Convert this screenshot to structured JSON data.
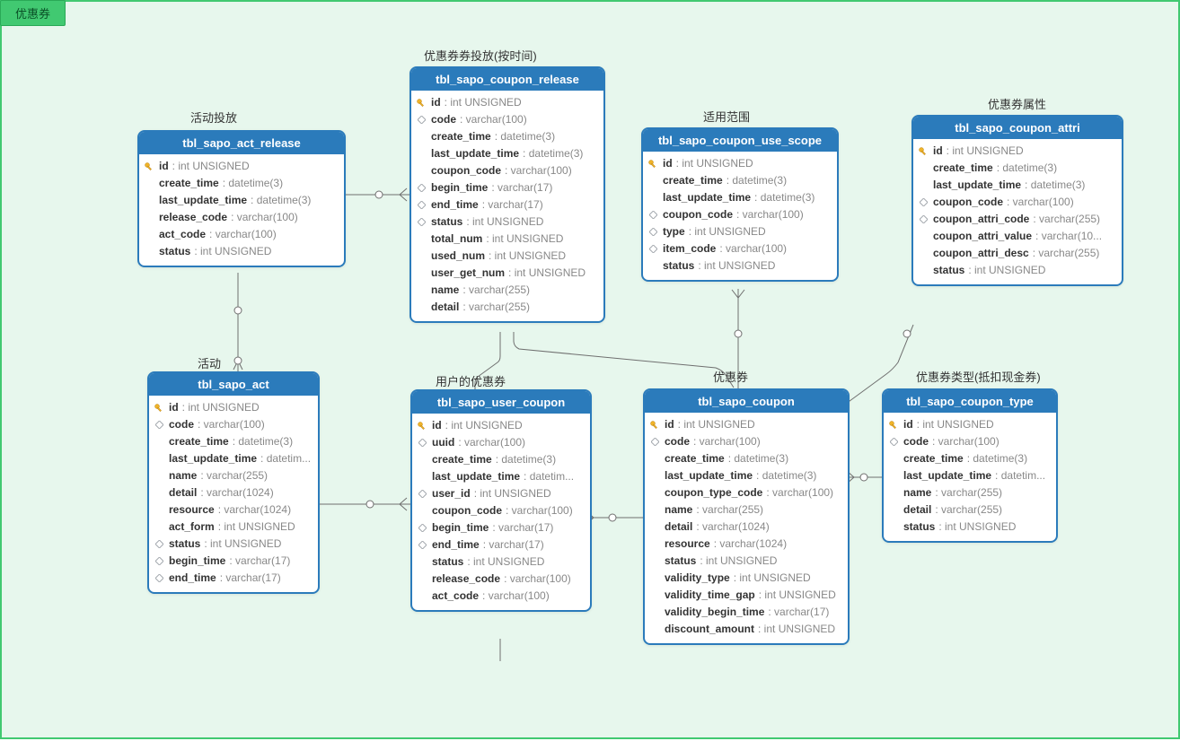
{
  "frame_tag": "优惠券",
  "labels": {
    "act_release": "活动投放",
    "act": "活动",
    "coupon_release": "优惠券券投放(按时间)",
    "user_coupon": "用户的优惠券",
    "coupon": "优惠券",
    "use_scope": "适用范围",
    "attri": "优惠券属性",
    "type": "优惠券类型(抵扣现金券)"
  },
  "entities": {
    "act_release": {
      "name": "tbl_sapo_act_release",
      "cols": [
        {
          "icon": "pk",
          "name": "id",
          "type": "int UNSIGNED"
        },
        {
          "icon": "",
          "name": "create_time",
          "type": "datetime(3)"
        },
        {
          "icon": "",
          "name": "last_update_time",
          "type": "datetime(3)"
        },
        {
          "icon": "",
          "name": "release_code",
          "type": "varchar(100)"
        },
        {
          "icon": "",
          "name": "act_code",
          "type": "varchar(100)"
        },
        {
          "icon": "",
          "name": "status",
          "type": "int UNSIGNED"
        }
      ]
    },
    "act": {
      "name": "tbl_sapo_act",
      "cols": [
        {
          "icon": "pk",
          "name": "id",
          "type": "int UNSIGNED"
        },
        {
          "icon": "idx",
          "name": "code",
          "type": "varchar(100)"
        },
        {
          "icon": "",
          "name": "create_time",
          "type": "datetime(3)"
        },
        {
          "icon": "",
          "name": "last_update_time",
          "type": "datetim..."
        },
        {
          "icon": "",
          "name": "name",
          "type": "varchar(255)"
        },
        {
          "icon": "",
          "name": "detail",
          "type": "varchar(1024)"
        },
        {
          "icon": "",
          "name": "resource",
          "type": "varchar(1024)"
        },
        {
          "icon": "",
          "name": "act_form",
          "type": "int UNSIGNED"
        },
        {
          "icon": "idx",
          "name": "status",
          "type": "int UNSIGNED"
        },
        {
          "icon": "idx",
          "name": "begin_time",
          "type": "varchar(17)"
        },
        {
          "icon": "idx",
          "name": "end_time",
          "type": "varchar(17)"
        }
      ]
    },
    "coupon_release": {
      "name": "tbl_sapo_coupon_release",
      "cols": [
        {
          "icon": "pk",
          "name": "id",
          "type": "int UNSIGNED"
        },
        {
          "icon": "idx",
          "name": "code",
          "type": "varchar(100)"
        },
        {
          "icon": "",
          "name": "create_time",
          "type": "datetime(3)"
        },
        {
          "icon": "",
          "name": "last_update_time",
          "type": "datetime(3)"
        },
        {
          "icon": "",
          "name": "coupon_code",
          "type": "varchar(100)"
        },
        {
          "icon": "idx",
          "name": "begin_time",
          "type": "varchar(17)"
        },
        {
          "icon": "idx",
          "name": "end_time",
          "type": "varchar(17)"
        },
        {
          "icon": "idx",
          "name": "status",
          "type": "int UNSIGNED"
        },
        {
          "icon": "",
          "name": "total_num",
          "type": "int UNSIGNED"
        },
        {
          "icon": "",
          "name": "used_num",
          "type": "int UNSIGNED"
        },
        {
          "icon": "",
          "name": "user_get_num",
          "type": "int UNSIGNED"
        },
        {
          "icon": "",
          "name": "name",
          "type": "varchar(255)"
        },
        {
          "icon": "",
          "name": "detail",
          "type": "varchar(255)"
        }
      ]
    },
    "user_coupon": {
      "name": "tbl_sapo_user_coupon",
      "cols": [
        {
          "icon": "pk",
          "name": "id",
          "type": "int UNSIGNED"
        },
        {
          "icon": "idx",
          "name": "uuid",
          "type": "varchar(100)"
        },
        {
          "icon": "",
          "name": "create_time",
          "type": "datetime(3)"
        },
        {
          "icon": "",
          "name": "last_update_time",
          "type": "datetim..."
        },
        {
          "icon": "idx",
          "name": "user_id",
          "type": "int UNSIGNED"
        },
        {
          "icon": "",
          "name": "coupon_code",
          "type": "varchar(100)"
        },
        {
          "icon": "idx",
          "name": "begin_time",
          "type": "varchar(17)"
        },
        {
          "icon": "idx",
          "name": "end_time",
          "type": "varchar(17)"
        },
        {
          "icon": "",
          "name": "status",
          "type": "int UNSIGNED"
        },
        {
          "icon": "",
          "name": "release_code",
          "type": "varchar(100)"
        },
        {
          "icon": "",
          "name": "act_code",
          "type": "varchar(100)"
        }
      ]
    },
    "coupon": {
      "name": "tbl_sapo_coupon",
      "cols": [
        {
          "icon": "pk",
          "name": "id",
          "type": "int UNSIGNED"
        },
        {
          "icon": "idx",
          "name": "code",
          "type": "varchar(100)"
        },
        {
          "icon": "",
          "name": "create_time",
          "type": "datetime(3)"
        },
        {
          "icon": "",
          "name": "last_update_time",
          "type": "datetime(3)"
        },
        {
          "icon": "",
          "name": "coupon_type_code",
          "type": "varchar(100)"
        },
        {
          "icon": "",
          "name": "name",
          "type": "varchar(255)"
        },
        {
          "icon": "",
          "name": "detail",
          "type": "varchar(1024)"
        },
        {
          "icon": "",
          "name": "resource",
          "type": "varchar(1024)"
        },
        {
          "icon": "",
          "name": "status",
          "type": "int UNSIGNED"
        },
        {
          "icon": "",
          "name": "validity_type",
          "type": "int UNSIGNED"
        },
        {
          "icon": "",
          "name": "validity_time_gap",
          "type": "int UNSIGNED"
        },
        {
          "icon": "",
          "name": "validity_begin_time",
          "type": "varchar(17)"
        },
        {
          "icon": "",
          "name": "discount_amount",
          "type": "int UNSIGNED"
        }
      ]
    },
    "use_scope": {
      "name": "tbl_sapo_coupon_use_scope",
      "cols": [
        {
          "icon": "pk",
          "name": "id",
          "type": "int UNSIGNED"
        },
        {
          "icon": "",
          "name": "create_time",
          "type": "datetime(3)"
        },
        {
          "icon": "",
          "name": "last_update_time",
          "type": "datetime(3)"
        },
        {
          "icon": "idx",
          "name": "coupon_code",
          "type": "varchar(100)"
        },
        {
          "icon": "idx",
          "name": "type",
          "type": "int UNSIGNED"
        },
        {
          "icon": "idx",
          "name": "item_code",
          "type": "varchar(100)"
        },
        {
          "icon": "",
          "name": "status",
          "type": "int UNSIGNED"
        }
      ]
    },
    "attri": {
      "name": "tbl_sapo_coupon_attri",
      "cols": [
        {
          "icon": "pk",
          "name": "id",
          "type": "int UNSIGNED"
        },
        {
          "icon": "",
          "name": "create_time",
          "type": "datetime(3)"
        },
        {
          "icon": "",
          "name": "last_update_time",
          "type": "datetime(3)"
        },
        {
          "icon": "idx",
          "name": "coupon_code",
          "type": "varchar(100)"
        },
        {
          "icon": "idx",
          "name": "coupon_attri_code",
          "type": "varchar(255)"
        },
        {
          "icon": "",
          "name": "coupon_attri_value",
          "type": "varchar(10..."
        },
        {
          "icon": "",
          "name": "coupon_attri_desc",
          "type": "varchar(255)"
        },
        {
          "icon": "",
          "name": "status",
          "type": "int UNSIGNED"
        }
      ]
    },
    "type": {
      "name": "tbl_sapo_coupon_type",
      "cols": [
        {
          "icon": "pk",
          "name": "id",
          "type": "int UNSIGNED"
        },
        {
          "icon": "idx",
          "name": "code",
          "type": "varchar(100)"
        },
        {
          "icon": "",
          "name": "create_time",
          "type": "datetime(3)"
        },
        {
          "icon": "",
          "name": "last_update_time",
          "type": "datetim..."
        },
        {
          "icon": "",
          "name": "name",
          "type": "varchar(255)"
        },
        {
          "icon": "",
          "name": "detail",
          "type": "varchar(255)"
        },
        {
          "icon": "",
          "name": "status",
          "type": "int UNSIGNED"
        }
      ]
    }
  }
}
